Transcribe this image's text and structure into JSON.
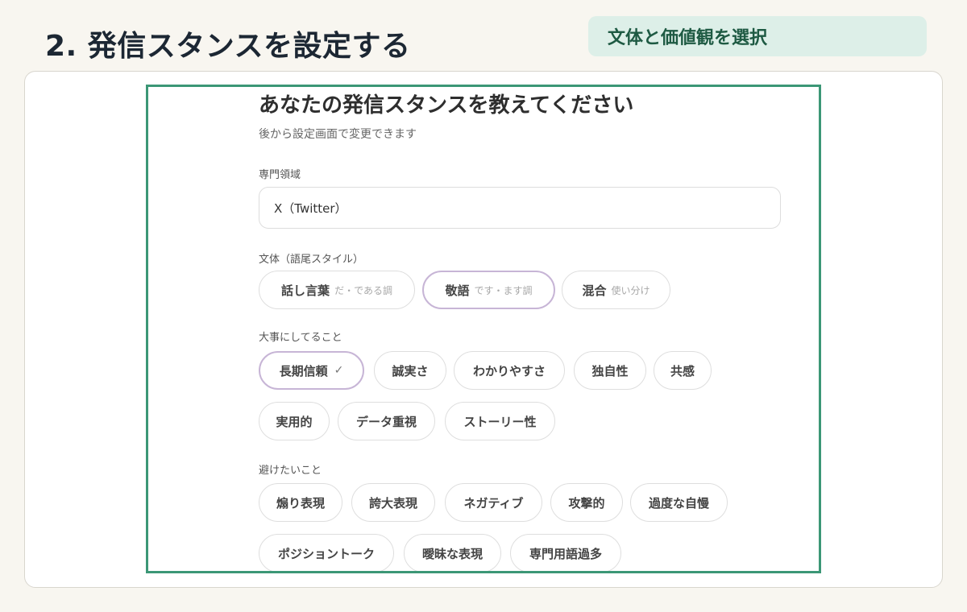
{
  "header": {
    "step_title": "2. 発信スタンスを設定する",
    "tag": "文体と価値観を選択"
  },
  "form": {
    "title": "あなたの発信スタンスを教えてください",
    "subtitle": "後から設定画面で変更できます",
    "expertise": {
      "label": "専門領域",
      "value": "X（Twitter）"
    },
    "style": {
      "label": "文体（語尾スタイル）",
      "options": [
        {
          "label": "話し言葉",
          "hint": "だ・である調"
        },
        {
          "label": "敬語",
          "hint": "です・ます調",
          "selected": true
        },
        {
          "label": "混合",
          "hint": "使い分け"
        }
      ]
    },
    "values": {
      "label": "大事にしてること",
      "options": [
        {
          "label": "長期信頼",
          "check": "✓",
          "selected": true
        },
        {
          "label": "誠実さ"
        },
        {
          "label": "わかりやすさ"
        },
        {
          "label": "独自性"
        },
        {
          "label": "共感"
        },
        {
          "label": "実用的"
        },
        {
          "label": "データ重視"
        },
        {
          "label": "ストーリー性"
        }
      ]
    },
    "avoid": {
      "label": "避けたいこと",
      "options": [
        {
          "label": "煽り表現"
        },
        {
          "label": "誇大表現"
        },
        {
          "label": "ネガティブ"
        },
        {
          "label": "攻撃的"
        },
        {
          "label": "過度な自慢"
        },
        {
          "label": "ポジショントーク"
        },
        {
          "label": "曖昧な表現"
        },
        {
          "label": "専門用語過多"
        }
      ]
    }
  },
  "colors": {
    "frame_border": "#3c9776",
    "tag_background": "#ddefe8",
    "selected_chip_border": "#c7b5d6"
  }
}
